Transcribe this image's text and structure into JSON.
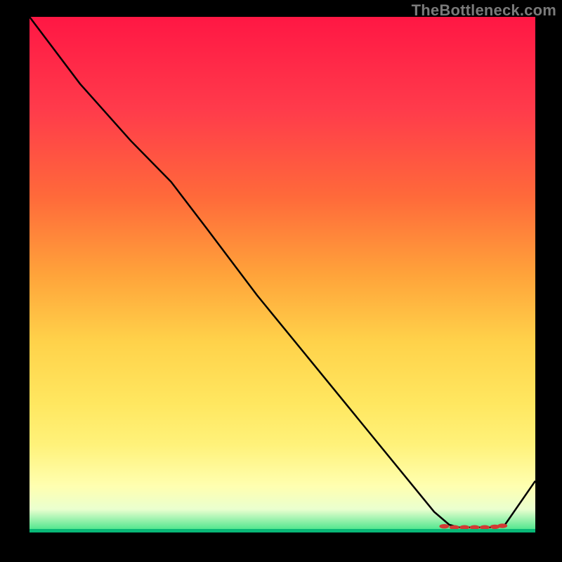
{
  "watermark": "TheBottleneck.com",
  "chart_data": {
    "type": "line",
    "title": "",
    "xlabel": "",
    "ylabel": "",
    "xlim": [
      0,
      100
    ],
    "ylim": [
      0,
      100
    ],
    "grid": false,
    "series": [
      {
        "name": "curve",
        "x": [
          0,
          10,
          20,
          28,
          35,
          45,
          55,
          65,
          75,
          80,
          83,
          85,
          88,
          90,
          92,
          94,
          100
        ],
        "y": [
          100,
          87,
          76,
          68,
          59,
          46,
          34,
          22,
          10,
          4,
          1.5,
          1,
          1,
          1,
          1,
          1.5,
          10
        ]
      }
    ],
    "markers": {
      "name": "highlight-points",
      "x": [
        82,
        84,
        86,
        88,
        90,
        92,
        93.5
      ],
      "y": [
        1.2,
        1.0,
        1.0,
        1.0,
        1.0,
        1.1,
        1.3
      ]
    },
    "background": {
      "type": "vertical-gradient",
      "stops": [
        {
          "pos": 0.0,
          "color": "#ff1744"
        },
        {
          "pos": 0.5,
          "color": "#ffa33a"
        },
        {
          "pos": 0.83,
          "color": "#fff27a"
        },
        {
          "pos": 0.95,
          "color": "#ffffb0"
        },
        {
          "pos": 1.0,
          "color": "#09b877"
        }
      ]
    }
  }
}
